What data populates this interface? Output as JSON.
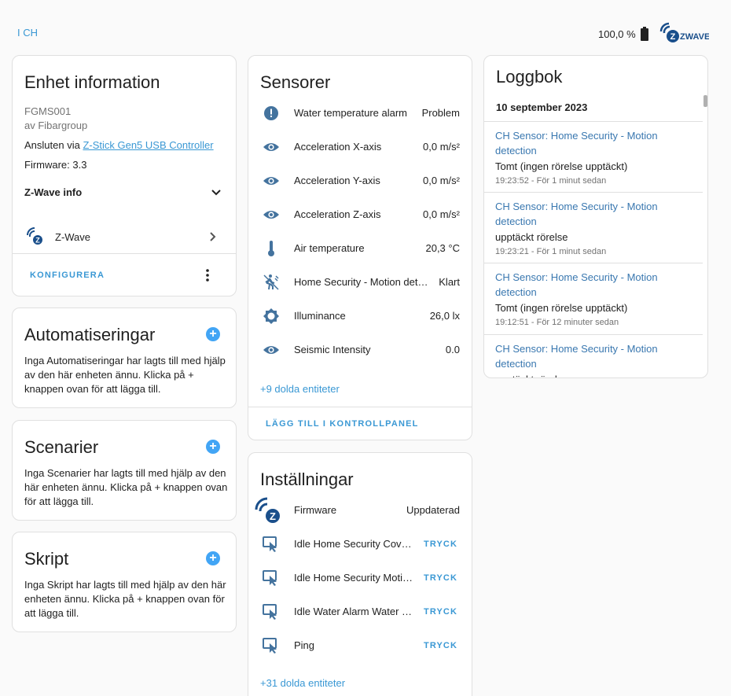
{
  "header": {
    "area": "I CH",
    "battery": "100,0 %",
    "zwave_logo": "ZWAVE"
  },
  "device_info": {
    "title": "Enhet information",
    "model": "FGMS001",
    "manufacturer": "av Fibargroup",
    "connected_prefix": "Ansluten via ",
    "connected_link": "Z-Stick Gen5 USB Controller",
    "firmware": "Firmware: 3.3",
    "zwave_info_label": "Z-Wave info",
    "integration_label": "Z-Wave",
    "configure_label": "KONFIGURERA"
  },
  "automations": {
    "title": "Automatiseringar",
    "text": "Inga Automatiseringar har lagts till med hjälp av den här enheten ännu. Klicka på + knappen ovan för att lägga till."
  },
  "scenes": {
    "title": "Scenarier",
    "text": "Inga Scenarier har lagts till med hjälp av den här enheten ännu. Klicka på + knappen ovan för att lägga till."
  },
  "scripts": {
    "title": "Skript",
    "text": "Inga Skript har lagts till med hjälp av den här enheten ännu. Klicka på + knappen ovan för att lägga till."
  },
  "sensors": {
    "title": "Sensorer",
    "rows": [
      {
        "icon": "alert-circle-icon",
        "name": "Water temperature alarm",
        "value": "Problem"
      },
      {
        "icon": "eye-icon",
        "name": "Acceleration X-axis",
        "value": "0,0 m/s²"
      },
      {
        "icon": "eye-icon",
        "name": "Acceleration Y-axis",
        "value": "0,0 m/s²"
      },
      {
        "icon": "eye-icon",
        "name": "Acceleration Z-axis",
        "value": "0,0 m/s²"
      },
      {
        "icon": "thermometer-icon",
        "name": "Air temperature",
        "value": "20,3 °C"
      },
      {
        "icon": "motion-sensor-icon",
        "name": "Home Security - Motion detection",
        "value": "Klart"
      },
      {
        "icon": "brightness-icon",
        "name": "Illuminance",
        "value": "26,0 lx"
      },
      {
        "icon": "eye-icon",
        "name": "Seismic Intensity",
        "value": "0.0"
      }
    ],
    "hidden": "+9 dolda entiteter",
    "add_to_dashboard": "LÄGG TILL I KONTROLLPANEL"
  },
  "settings": {
    "title": "Inställningar",
    "firmware_name": "Firmware",
    "firmware_value": "Uppdaterad",
    "rows": [
      {
        "icon": "gesture-tap-button-icon",
        "name": "Idle Home Security Cover status",
        "action": "TRYCK"
      },
      {
        "icon": "gesture-tap-button-icon",
        "name": "Idle Home Security Motion sensor status",
        "action": "TRYCK"
      },
      {
        "icon": "gesture-tap-button-icon",
        "name": "Idle Water Alarm Water temperature status",
        "action": "TRYCK"
      },
      {
        "icon": "gesture-tap-button-icon",
        "name": "Ping",
        "action": "TRYCK"
      }
    ],
    "hidden": "+31 dolda entiteter"
  },
  "logbook": {
    "title": "Loggbok",
    "date": "10 september 2023",
    "entries": [
      {
        "title": "CH Sensor: Home Security - Motion detection",
        "message": "Tomt (ingen rörelse upptäckt)",
        "time": "19:23:52 - För 1 minut sedan"
      },
      {
        "title": "CH Sensor: Home Security - Motion detection",
        "message": "upptäckt rörelse",
        "time": "19:23:21 - För 1 minut sedan"
      },
      {
        "title": "CH Sensor: Home Security - Motion detection",
        "message": "Tomt (ingen rörelse upptäckt)",
        "time": "19:12:51 - För 12 minuter sedan"
      },
      {
        "title": "CH Sensor: Home Security - Motion detection",
        "message": "upptäckt rörelse",
        "time": ""
      }
    ]
  },
  "colors": {
    "accent": "#3a98d4",
    "icon": "#44739e",
    "zwave_blue": "#1a4f8b"
  }
}
